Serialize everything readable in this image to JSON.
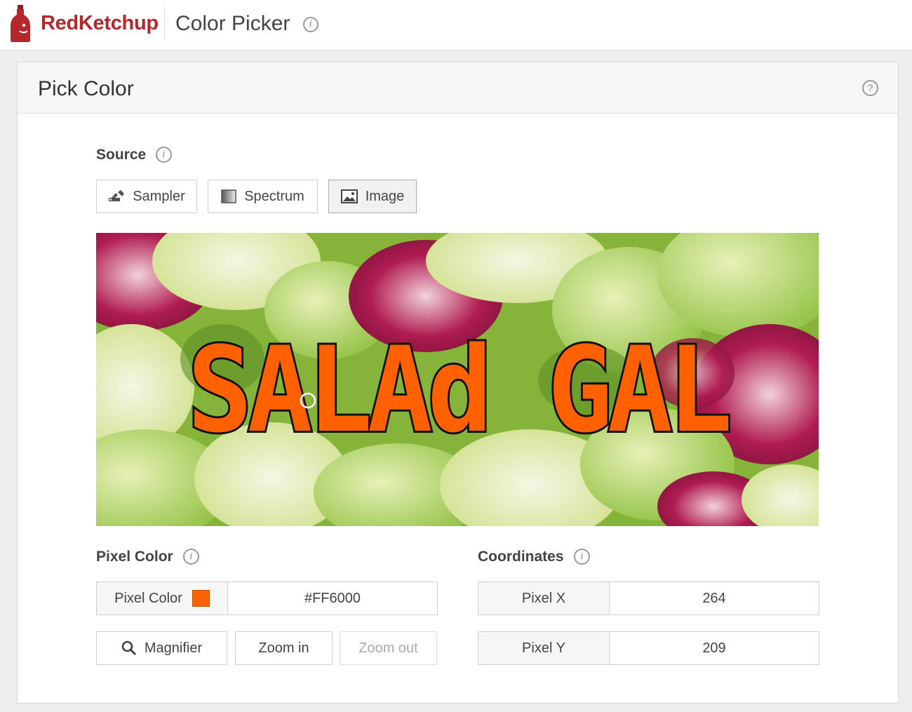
{
  "header": {
    "brand": "RedKetchup",
    "app_title": "Color Picker",
    "brand_color": "#b3272d"
  },
  "card": {
    "title": "Pick Color"
  },
  "source": {
    "label": "Source",
    "buttons": [
      {
        "label": "Sampler",
        "icon": "sampler-icon",
        "active": false
      },
      {
        "label": "Spectrum",
        "icon": "spectrum-icon",
        "active": false
      },
      {
        "label": "Image",
        "icon": "image-icon",
        "active": true
      }
    ]
  },
  "image": {
    "overlay_text": "SALAd GAL",
    "overlay_color": "#FF6000"
  },
  "pixel_color": {
    "label": "Pixel Color",
    "field_label": "Pixel Color",
    "value": "#FF6000",
    "swatch_color": "#FF6000"
  },
  "tools": {
    "magnifier": "Magnifier",
    "zoom_in": "Zoom in",
    "zoom_out": "Zoom out"
  },
  "coordinates": {
    "label": "Coordinates",
    "x_label": "Pixel X",
    "x_value": "264",
    "y_label": "Pixel Y",
    "y_value": "209"
  }
}
